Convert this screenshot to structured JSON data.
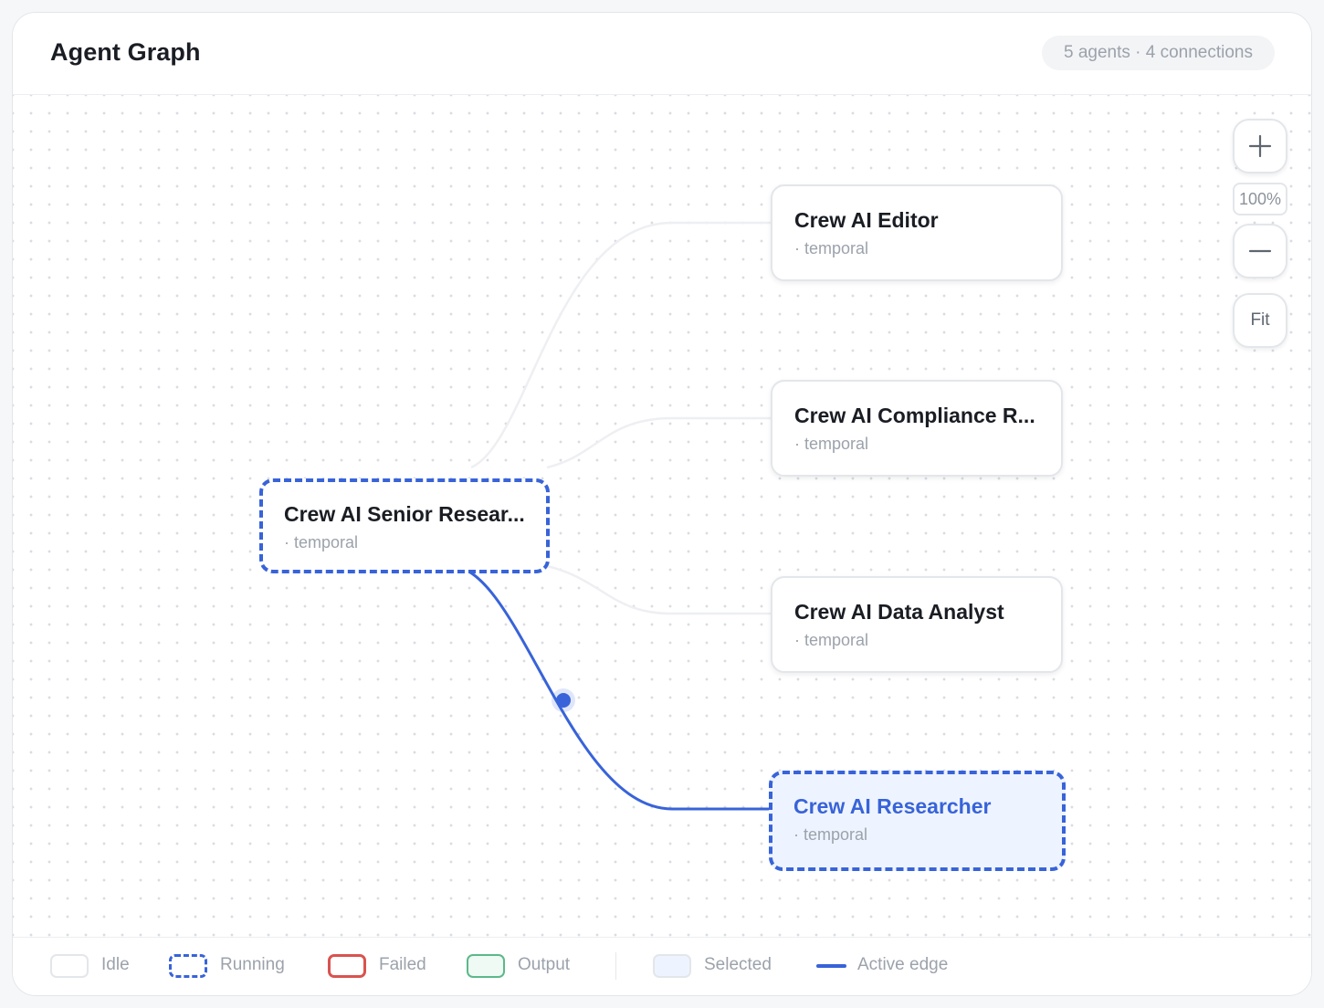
{
  "header": {
    "title": "Agent Graph",
    "summary": "5 agents · 4 connections"
  },
  "nodes": [
    {
      "id": "senior-researcher",
      "name": "Crew AI Senior Resear...",
      "meta": "· temporal",
      "state": "running",
      "selected": false
    },
    {
      "id": "editor",
      "name": "Crew AI Editor",
      "meta": "· temporal",
      "state": "idle",
      "selected": false
    },
    {
      "id": "compliance",
      "name": "Crew AI Compliance R...",
      "meta": "· temporal",
      "state": "idle",
      "selected": false
    },
    {
      "id": "data-analyst",
      "name": "Crew AI Data Analyst",
      "meta": "· temporal",
      "state": "idle",
      "selected": false
    },
    {
      "id": "researcher",
      "name": "Crew AI Researcher",
      "meta": "· temporal",
      "state": "running",
      "selected": true
    }
  ],
  "edges": [
    {
      "from": "senior-researcher",
      "to": "editor",
      "active": false
    },
    {
      "from": "senior-researcher",
      "to": "compliance",
      "active": false
    },
    {
      "from": "senior-researcher",
      "to": "data-analyst",
      "active": false
    },
    {
      "from": "senior-researcher",
      "to": "researcher",
      "active": true
    }
  ],
  "zoom": {
    "zoom_in_icon": "plus-icon",
    "level": "100%",
    "zoom_out_icon": "minus-icon",
    "fit_label": "Fit"
  },
  "legend": {
    "idle": "Idle",
    "running": "Running",
    "failed": "Failed",
    "output": "Output",
    "selected": "Selected",
    "active_edge": "Active edge"
  },
  "colors": {
    "accent": "#3863d9",
    "idle_border": "#e3e6ea",
    "failed": "#d9534f",
    "output": "#5cb88a",
    "selected_fill": "#eef4ff",
    "inactive_edge": "#eeeff2"
  }
}
